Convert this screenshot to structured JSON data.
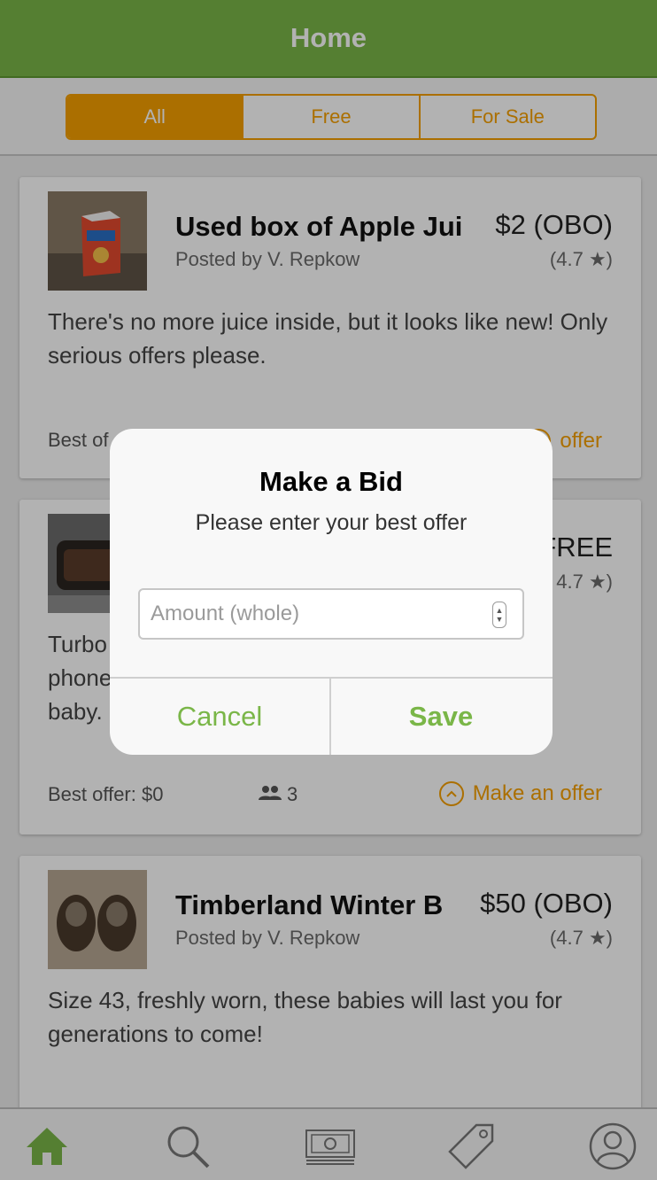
{
  "header": {
    "title": "Home"
  },
  "filter": {
    "tabs": [
      "All",
      "Free",
      "For Sale"
    ],
    "selected": "All"
  },
  "listings": [
    {
      "title": "Used box of Apple Jui",
      "author": "Posted by V. Repkow",
      "price": "$2 (OBO)",
      "rating": "(4.7 ★)",
      "description": "There's no more juice inside, but it looks like new! Only serious offers please.",
      "best_offer": "Best of",
      "offer_label": "offer"
    },
    {
      "title": "",
      "author": "",
      "price": "FREE",
      "rating": "4.7 ★)",
      "description_lines": [
        "Turbo",
        "phone",
        "baby."
      ],
      "best_offer": "Best offer: $0",
      "watchers": "3",
      "offer_label": "Make an offer"
    },
    {
      "title": "Timberland Winter B",
      "author": "Posted by V. Repkow",
      "price": "$50 (OBO)",
      "rating": "(4.7 ★)",
      "description": "Size 43, freshly worn, these babies will last you for generations to come!"
    }
  ],
  "dialog": {
    "title": "Make a Bid",
    "message": "Please enter your best offer",
    "input_placeholder": "Amount (whole)",
    "cancel_label": "Cancel",
    "save_label": "Save"
  },
  "tabbar": {
    "icons": [
      "home-icon",
      "search-icon",
      "cash-icon",
      "tag-icon",
      "profile-icon"
    ],
    "active": "home-icon"
  },
  "colors": {
    "brand_green": "#7ab648",
    "accent_orange": "#f59f00"
  }
}
